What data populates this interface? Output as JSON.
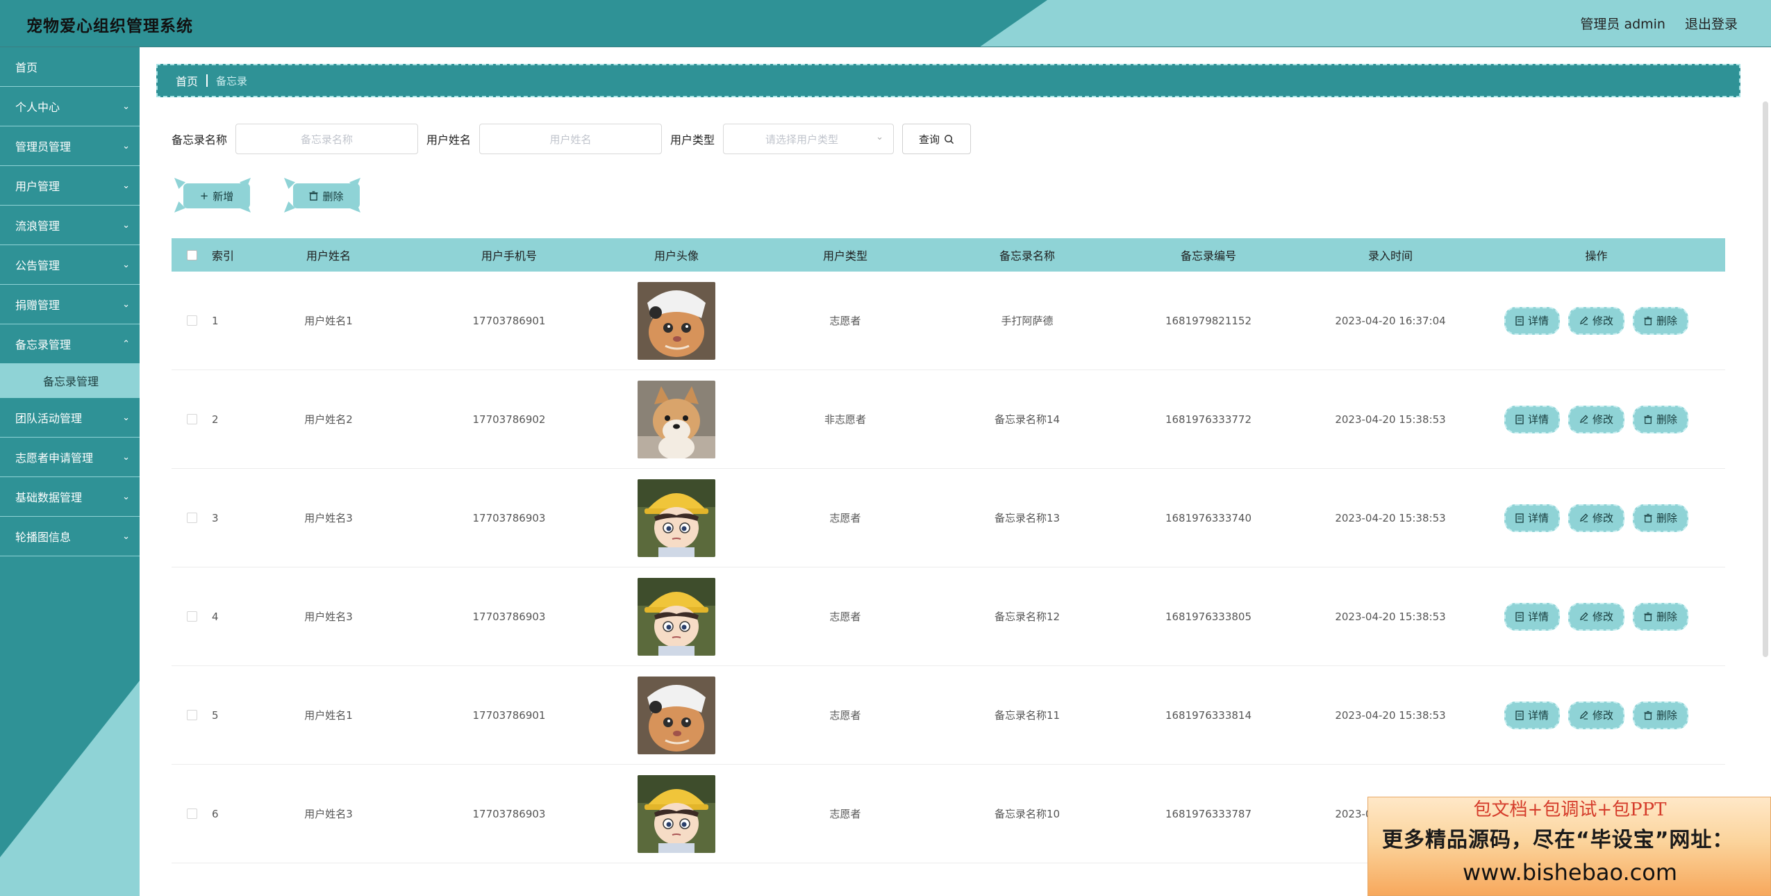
{
  "header": {
    "title": "宠物爱心组织管理系统",
    "user": "管理员 admin",
    "logout": "退出登录"
  },
  "sidebar": {
    "items": [
      {
        "label": "首页",
        "chev": false
      },
      {
        "label": "个人中心",
        "chev": true
      },
      {
        "label": "管理员管理",
        "chev": true
      },
      {
        "label": "用户管理",
        "chev": true
      },
      {
        "label": "流浪管理",
        "chev": true
      },
      {
        "label": "公告管理",
        "chev": true
      },
      {
        "label": "捐赠管理",
        "chev": true
      },
      {
        "label": "备忘录管理",
        "chev": true
      }
    ],
    "sub_active": "备忘录管理",
    "items_after": [
      {
        "label": "团队活动管理"
      },
      {
        "label": "志愿者申请管理"
      },
      {
        "label": "基础数据管理"
      },
      {
        "label": "轮播图信息"
      }
    ]
  },
  "breadcrumb": {
    "home": "首页",
    "current": "备忘录"
  },
  "search": {
    "memo_label": "备忘录名称",
    "memo_placeholder": "备忘录名称",
    "user_label": "用户姓名",
    "user_placeholder": "用户姓名",
    "type_label": "用户类型",
    "type_placeholder": "请选择用户类型",
    "query": "查询"
  },
  "actions": {
    "add": "新增",
    "delete": "删除"
  },
  "table": {
    "headers": [
      "索引",
      "用户姓名",
      "用户手机号",
      "用户头像",
      "用户类型",
      "备忘录名称",
      "备忘录编号",
      "录入时间",
      "操作"
    ],
    "ops": {
      "detail": "详情",
      "edit": "修改",
      "delete": "删除"
    },
    "rows": [
      {
        "idx": "1",
        "name": "用户姓名1",
        "phone": "17703786901",
        "avatar": "cat-icon",
        "type": "志愿者",
        "memo": "手打阿萨德",
        "no": "1681979821152",
        "time": "2023-04-20 16:37:04"
      },
      {
        "idx": "2",
        "name": "用户姓名2",
        "phone": "17703786902",
        "avatar": "dog-icon",
        "type": "非志愿者",
        "memo": "备忘录名称14",
        "no": "1681976333772",
        "time": "2023-04-20 15:38:53"
      },
      {
        "idx": "3",
        "name": "用户姓名3",
        "phone": "17703786903",
        "avatar": "cartoon-boy-icon",
        "type": "志愿者",
        "memo": "备忘录名称13",
        "no": "1681976333740",
        "time": "2023-04-20 15:38:53"
      },
      {
        "idx": "4",
        "name": "用户姓名3",
        "phone": "17703786903",
        "avatar": "cartoon-boy-icon",
        "type": "志愿者",
        "memo": "备忘录名称12",
        "no": "1681976333805",
        "time": "2023-04-20 15:38:53"
      },
      {
        "idx": "5",
        "name": "用户姓名1",
        "phone": "17703786901",
        "avatar": "cat-icon",
        "type": "志愿者",
        "memo": "备忘录名称11",
        "no": "1681976333814",
        "time": "2023-04-20 15:38:53"
      },
      {
        "idx": "6",
        "name": "用户姓名3",
        "phone": "17703786903",
        "avatar": "cartoon-boy-icon",
        "type": "志愿者",
        "memo": "备忘录名称10",
        "no": "1681976333787",
        "time": "2023-04-20 15:38:53"
      }
    ]
  },
  "promo": {
    "line1": "包文档+包调试+包PPT",
    "line2": "更多精品源码，尽在“毕设宝”网址：",
    "line3": "www.bishebao.com"
  },
  "colors": {
    "teal": "#2f9296",
    "light_teal": "#8fd3d6"
  }
}
